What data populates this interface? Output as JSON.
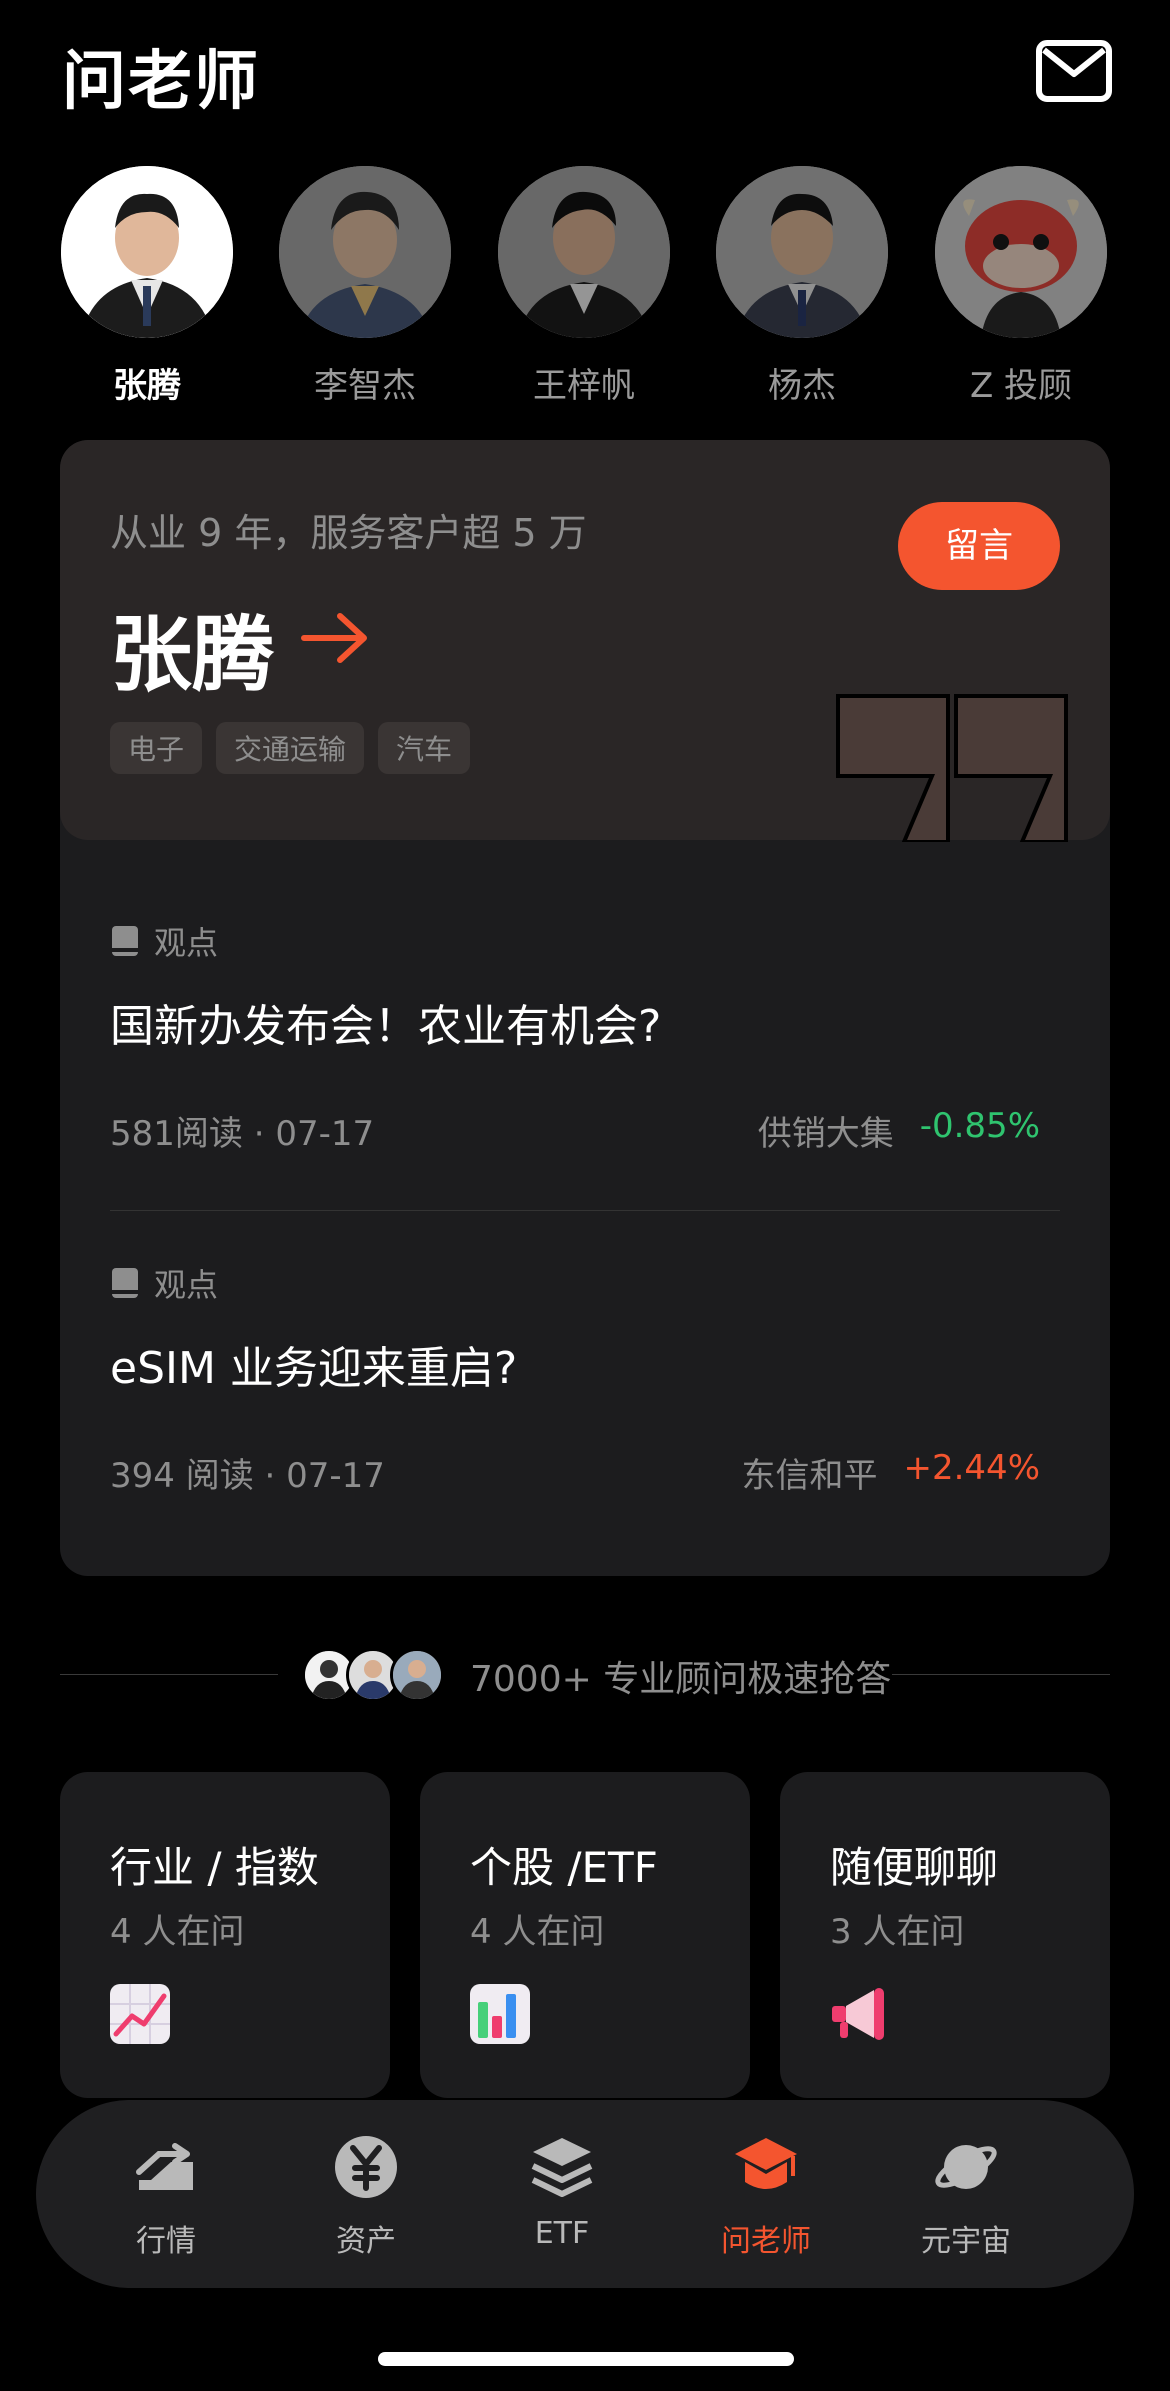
{
  "header": {
    "title": "问老师"
  },
  "advisors": [
    {
      "name": "张腾",
      "selected": true
    },
    {
      "name": "李智杰",
      "selected": false
    },
    {
      "name": "王梓帆",
      "selected": false
    },
    {
      "name": "杨杰",
      "selected": false
    },
    {
      "name": "Z 投顾",
      "selected": false
    }
  ],
  "card": {
    "experience": "从业 9 年，服务客户超 5 万",
    "message_button": "留言",
    "name": "张腾",
    "tags": [
      "电子",
      "交通运输",
      "汽车"
    ],
    "posts": [
      {
        "label": "观点",
        "title": "国新办发布会！农业有机会?",
        "meta": "581阅读 · 07-17",
        "stock": "供销大集",
        "change": "-0.85%"
      },
      {
        "label": "观点",
        "title": "eSIM 业务迎来重启?",
        "meta": "394 阅读 · 07-17",
        "stock": "东信和平",
        "change": "+2.44%"
      }
    ]
  },
  "experts_banner": "7000+ 专业顾问极速抢答",
  "topics": [
    {
      "title": "行业 / 指数",
      "subtitle": "4 人在问",
      "icon": "chart-line-icon"
    },
    {
      "title": "个股 /ETF",
      "subtitle": "4 人在问",
      "icon": "bar-chart-icon"
    },
    {
      "title": "随便聊聊",
      "subtitle": "3 人在问",
      "icon": "megaphone-icon"
    }
  ],
  "tabbar": [
    {
      "label": "行情",
      "icon": "market-icon",
      "active": false
    },
    {
      "label": "资产",
      "icon": "yen-icon",
      "active": false
    },
    {
      "label": "ETF",
      "icon": "layers-icon",
      "active": false
    },
    {
      "label": "问老师",
      "icon": "graduation-cap-icon",
      "active": true
    },
    {
      "label": "元宇宙",
      "icon": "planet-icon",
      "active": false
    }
  ],
  "colors": {
    "accent": "#f4552f",
    "down": "#2fc46f",
    "background": "#000000",
    "card": "#1c1c1e"
  }
}
